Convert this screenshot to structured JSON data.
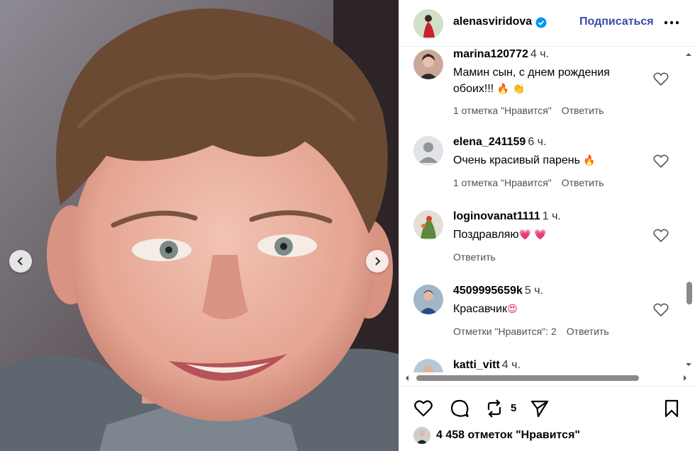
{
  "post": {
    "author": "alenasviridova",
    "follow_label": "Подписаться"
  },
  "comments": [
    {
      "user": "marina120772",
      "time": "4 ч.",
      "text": "Мамин сын, с днем рождения обоих!!!",
      "emojis": [
        "🔥",
        "👏"
      ],
      "likes_label": "1 отметка \"Нравится\"",
      "reply_label": "Ответить"
    },
    {
      "user": "elena_241159",
      "time": "6 ч.",
      "text": "Очень красивый парень",
      "emojis": [
        "🔥"
      ],
      "likes_label": "1 отметка \"Нравится\"",
      "reply_label": "Ответить"
    },
    {
      "user": "loginovanat1111",
      "time": "1 ч.",
      "text": "Поздравляю",
      "emojis": [
        "💗",
        "💗"
      ],
      "likes_label": "",
      "reply_label": "Ответить"
    },
    {
      "user": "4509995659k",
      "time": "5 ч.",
      "text": "Красавчик",
      "emojis": [
        "😍"
      ],
      "likes_label": "Отметки \"Нравится\": 2",
      "reply_label": "Ответить"
    },
    {
      "user": "katti_vitt",
      "time": "4 ч.",
      "text": "",
      "emojis": [],
      "likes_label": "",
      "reply_label": ""
    }
  ],
  "actions": {
    "repost_count": "5",
    "likes_count_label": "4 458 отметок \"Нравится\""
  },
  "icons": {
    "verified": "verified-badge-icon",
    "more": "more-options-icon",
    "like": "heart-icon",
    "comment": "comment-bubble-icon",
    "repost": "repost-icon",
    "share": "send-icon",
    "save": "bookmark-icon"
  },
  "colors": {
    "accent": "#3b4aa6",
    "verified": "#0095f6",
    "meta_text": "#505050"
  }
}
